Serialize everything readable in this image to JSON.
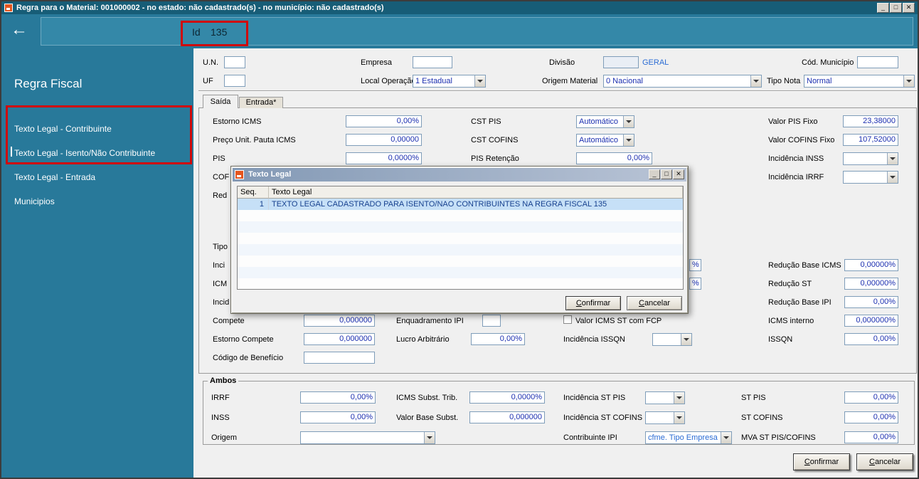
{
  "window": {
    "title": "Regra para o Material: 001000002 - no estado: não cadastrado(s) - no município: não cadastrado(s)",
    "controls": {
      "minimize": "_",
      "maximize": "□",
      "close": "✕"
    }
  },
  "header": {
    "back": "←",
    "id_label": "Id",
    "id_value": "135"
  },
  "sidebar": {
    "title": "Regra Fiscal",
    "items": [
      "Texto Legal - Contribuinte",
      "Texto Legal - Isento/Não Contribuinte",
      "Texto Legal - Entrada",
      "Municipios"
    ]
  },
  "topform": {
    "un": {
      "label": "U.N.",
      "value": ""
    },
    "empresa": {
      "label": "Empresa",
      "value": ""
    },
    "divisao": {
      "label": "Divisão",
      "value": "",
      "desc": "GERAL"
    },
    "cod_municipio": {
      "label": "Cód. Município",
      "value": ""
    },
    "uf": {
      "label": "UF",
      "value": ""
    },
    "local_operacao": {
      "label": "Local Operação",
      "value": "1 Estadual"
    },
    "origem_material": {
      "label": "Origem Material",
      "value": "0 Nacional"
    },
    "tipo_nota": {
      "label": "Tipo Nota",
      "value": "Normal"
    }
  },
  "tabs": {
    "saida": "Saída",
    "entrada": "Entrada*"
  },
  "saida": {
    "estorno_icms": {
      "label": "Estorno ICMS",
      "value": "0,00%"
    },
    "preco_pauta": {
      "label": "Preço Unit. Pauta ICMS",
      "value": "0,00000"
    },
    "pis": {
      "label": "PIS",
      "value": "0,0000%"
    },
    "cof_fragment": "COF",
    "red_fragment": "Red",
    "cst_pis": {
      "label": "CST PIS",
      "value": "Automático"
    },
    "cst_cofins": {
      "label": "CST COFINS",
      "value": "Automático"
    },
    "pis_retencao": {
      "label": "PIS Retenção",
      "value": "0,00%"
    },
    "valor_pis_fixo": {
      "label": "Valor PIS Fixo",
      "value": "23,38000"
    },
    "valor_cofins_fixo": {
      "label": "Valor COFINS Fixo",
      "value": "107,52000"
    },
    "incidencia_inss": {
      "label": "Incidência INSS",
      "value": ""
    },
    "incidencia_irrf": {
      "label": "Incidência IRRF",
      "value": ""
    }
  },
  "mid": {
    "fragments": [
      "Tipo",
      "Inci",
      "ICM",
      "Incid"
    ],
    "slivers": [
      "%",
      "%"
    ],
    "compete": {
      "label": "Compete",
      "value": "0,000000"
    },
    "enquadramento": {
      "label": "Enquadramento IPI",
      "value": ""
    },
    "fcp_label": "Valor ICMS ST com FCP",
    "estorno_compete": {
      "label": "Estorno Compete",
      "value": "0,000000"
    },
    "lucro_arbitrario": {
      "label": "Lucro Arbitrário",
      "value": "0,00%"
    },
    "incidencia_issqn": {
      "label": "Incidência ISSQN",
      "value": ""
    },
    "codigo_beneficio": {
      "label": "Código de Benefício",
      "value": ""
    },
    "reducao_base_icms": {
      "label": "Redução Base ICMS",
      "value": "0,00000%"
    },
    "reducao_st": {
      "label": "Redução ST",
      "value": "0,00000%"
    },
    "reducao_base_ipi": {
      "label": "Redução Base IPI",
      "value": "0,00%"
    },
    "icms_interno": {
      "label": "ICMS interno",
      "value": "0,000000%"
    },
    "issqn": {
      "label": "ISSQN",
      "value": "0,00%"
    }
  },
  "ambos": {
    "title": "Ambos",
    "irrf": {
      "label": "IRRF",
      "value": "0,00%"
    },
    "inss": {
      "label": "INSS",
      "value": "0,00%"
    },
    "origem": {
      "label": "Origem",
      "value": ""
    },
    "icms_subst": {
      "label": "ICMS Subst. Trib.",
      "value": "0,0000%"
    },
    "valor_base_subst": {
      "label": "Valor Base Subst.",
      "value": "0,000000"
    },
    "incidencia_st_pis": {
      "label": "Incidência ST PIS",
      "value": ""
    },
    "incidencia_st_cofins": {
      "label": "Incidência ST COFINS",
      "value": ""
    },
    "contribuinte_ipi": {
      "label": "Contribuinte IPI",
      "value": "cfme. Tipo Empresa"
    },
    "st_pis": {
      "label": "ST PIS",
      "value": "0,00%"
    },
    "st_cofins": {
      "label": "ST COFINS",
      "value": "0,00%"
    },
    "mva": {
      "label": "MVA ST PIS/COFINS",
      "value": "0,00%"
    }
  },
  "footer": {
    "confirmar": "Confirmar",
    "cancelar": "Cancelar"
  },
  "dialog": {
    "title": "Texto Legal",
    "controls": {
      "minimize": "_",
      "maximize": "□",
      "close": "✕"
    },
    "columns": [
      "Seq.",
      "Texto Legal"
    ],
    "rows": [
      {
        "seq": "1",
        "texto": "TEXTO LEGAL CADASTRADO PARA ISENTO/NAO CONTRIBUINTES NA REGRA FISCAL 135"
      }
    ],
    "confirmar": "Confirmar",
    "cancelar": "Cancelar"
  },
  "colors": {
    "titlebar_teal": "#175d77",
    "sidebar_teal": "#28799a",
    "header_panel_teal": "#3488a8",
    "value_blue": "#1c2fb0",
    "link_blue": "#2b6cd4",
    "selected_row": "#c6e0f7",
    "annotation_red": "#cf0a0a"
  }
}
